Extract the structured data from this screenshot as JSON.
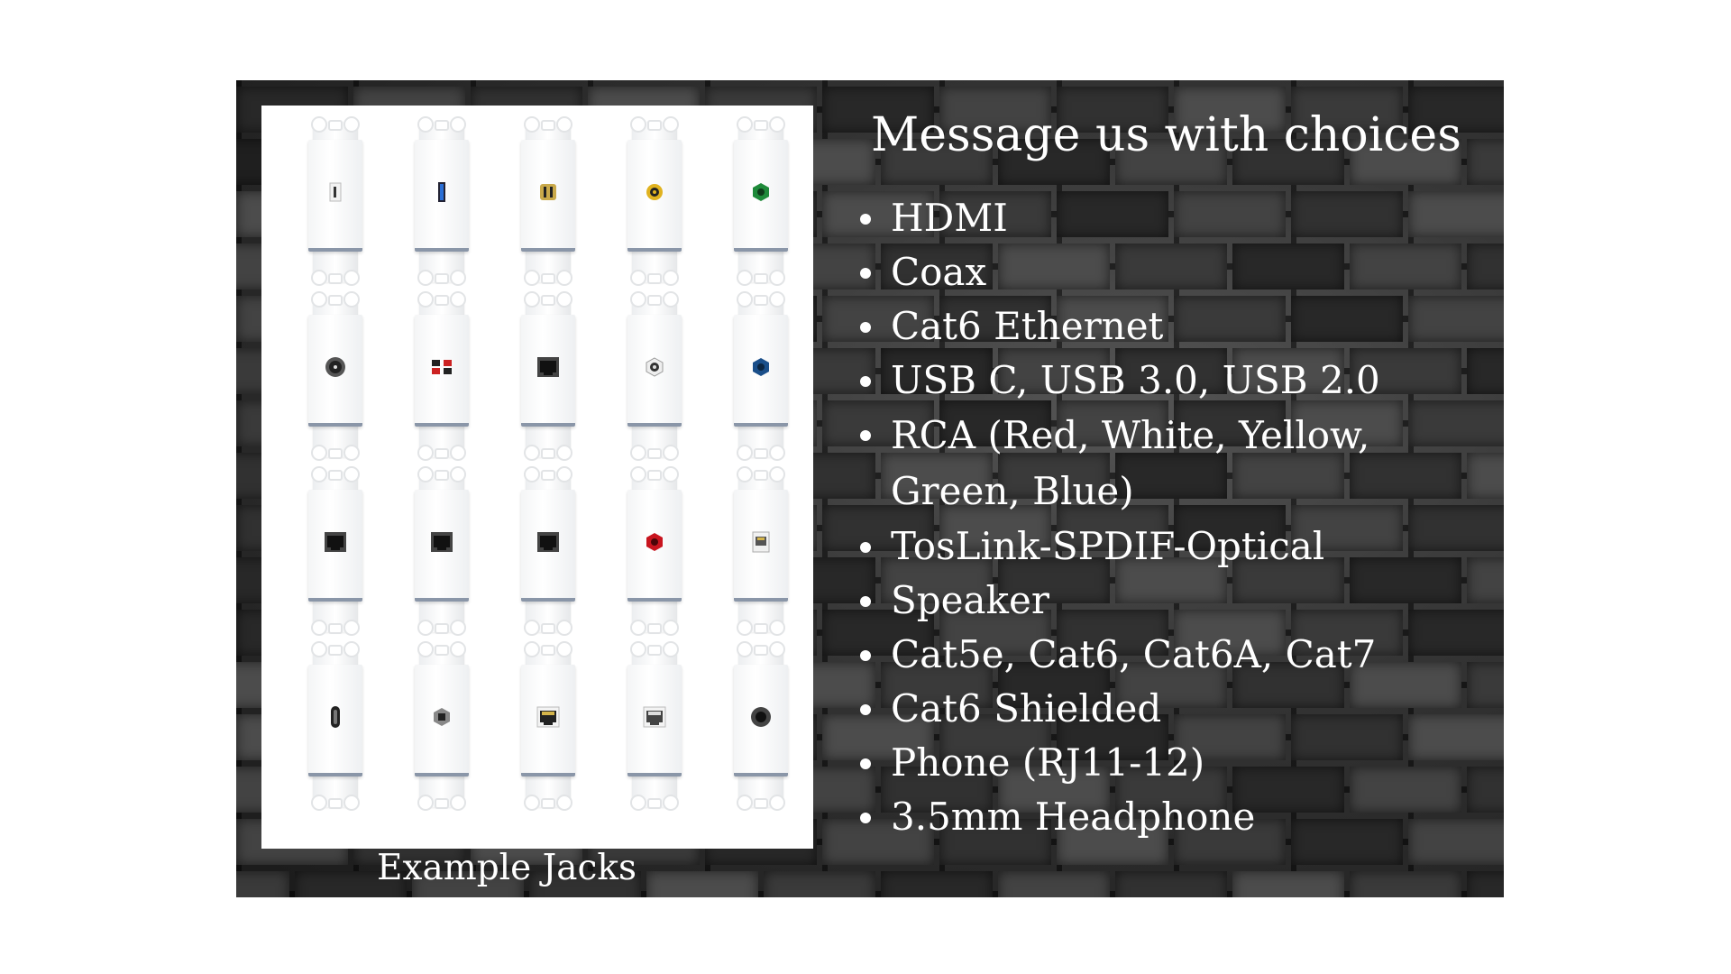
{
  "panel": {
    "caption": "Example Jacks",
    "jacks": [
      {
        "name": "usb-jack-icon",
        "kind": "usb-white"
      },
      {
        "name": "usb3-jack-icon",
        "kind": "usb-blue"
      },
      {
        "name": "hdmi-gold-jack-icon",
        "kind": "hdmi-gold"
      },
      {
        "name": "rca-yellow-jack-icon",
        "kind": "rca-yellow"
      },
      {
        "name": "rca-green-jack-icon",
        "kind": "rca-green"
      },
      {
        "name": "coax-jack-icon",
        "kind": "coax"
      },
      {
        "name": "speaker-terminal-icon",
        "kind": "speaker"
      },
      {
        "name": "ethernet-jack-icon",
        "kind": "rj45-dark"
      },
      {
        "name": "rca-white-jack-icon",
        "kind": "rca-white"
      },
      {
        "name": "rca-blue-jack-icon",
        "kind": "rca-blue"
      },
      {
        "name": "cat5e-jack-icon",
        "kind": "rj45-dark"
      },
      {
        "name": "cat6-jack-icon",
        "kind": "rj45-dark"
      },
      {
        "name": "cat6a-jack-icon",
        "kind": "rj45-dark"
      },
      {
        "name": "rca-red-jack-icon",
        "kind": "rca-red"
      },
      {
        "name": "phone-jack-icon",
        "kind": "rj11-white"
      },
      {
        "name": "usb-c-jack-icon",
        "kind": "usbc"
      },
      {
        "name": "toslink-jack-icon",
        "kind": "toslink"
      },
      {
        "name": "cat6-shielded-jack-icon",
        "kind": "rj45-gold"
      },
      {
        "name": "cat7-jack-icon",
        "kind": "rj45-white"
      },
      {
        "name": "headphone-jack-icon",
        "kind": "audio35"
      }
    ]
  },
  "content": {
    "heading": "Message us with choices",
    "items": [
      "HDMI",
      "Coax",
      "Cat6 Ethernet",
      "USB C, USB 3.0, USB 2.0",
      "RCA (Red, White, Yellow, Green, Blue)",
      "TosLink-SPDIF-Optical",
      "Speaker",
      "Cat5e, Cat6, Cat6A, Cat7",
      "Cat6 Shielded",
      "Phone (RJ11-12)",
      "3.5mm Headphone"
    ]
  }
}
